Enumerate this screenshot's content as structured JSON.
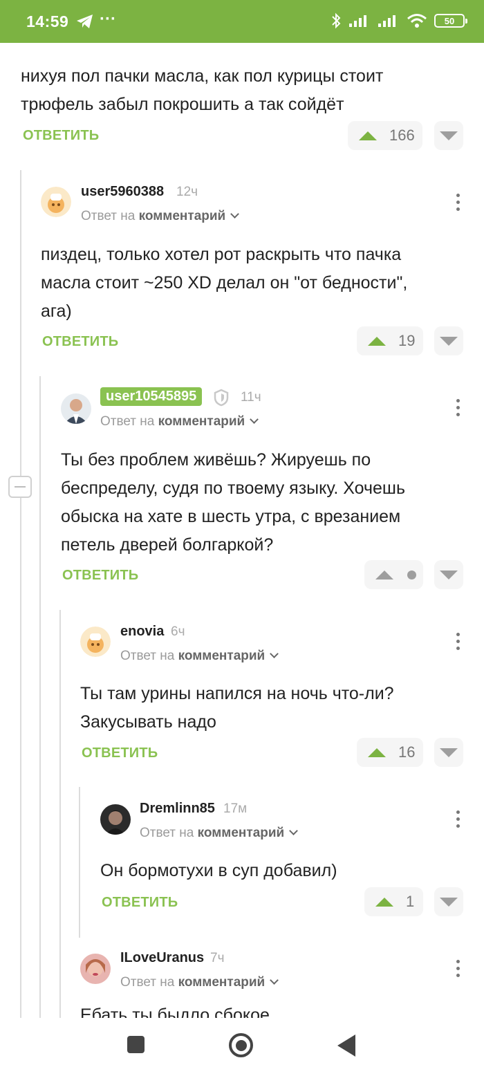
{
  "status_bar": {
    "time": "14:59",
    "battery": "50"
  },
  "top_comment": {
    "text_line1": "нихуя пол пачки масла, как пол курицы стоит",
    "text_line2": "трюфель забыл покрошить а так сойдёт",
    "reply": "ОТВЕТИТЬ",
    "votes": "166"
  },
  "comments": [
    {
      "username": "user5960388",
      "time_ago": "12ч",
      "reply_prefix": "Ответ на",
      "reply_target": "комментарий",
      "lines": [
        "пиздец, только хотел рот раскрыть что пачка",
        "масла стоит ~250 XD делал он \"от бедности\",",
        "ага)"
      ],
      "reply": "ОТВЕТИТЬ",
      "votes": "19"
    },
    {
      "username": "user10545895",
      "time_ago": "11ч",
      "reply_prefix": "Ответ на",
      "reply_target": "комментарий",
      "lines": [
        "Ты без проблем живёшь? Жируешь по",
        "беспределу, судя по твоему языку. Хочешь",
        "обыска на хате в шесть утра, с врезанием",
        "петель дверей болгаркой?"
      ],
      "reply": "ОТВЕТИТЬ",
      "votes": ""
    },
    {
      "username": "enovia",
      "time_ago": "6ч",
      "reply_prefix": "Ответ на",
      "reply_target": "комментарий",
      "lines": [
        "Ты там урины напился на ночь что-ли?",
        "Закусывать надо"
      ],
      "reply": "ОТВЕТИТЬ",
      "votes": "16"
    },
    {
      "username": "Dremlinn85",
      "time_ago": "17м",
      "reply_prefix": "Ответ на",
      "reply_target": "комментарий",
      "lines": [
        "Он бормотухи в суп добавил)"
      ],
      "reply": "ОТВЕТИТЬ",
      "votes": "1"
    },
    {
      "username": "ILoveUranus",
      "time_ago": "7ч",
      "reply_prefix": "Ответ на",
      "reply_target": "комментарий",
      "lines": [
        "Ебать ты быдло сбокое"
      ],
      "reply": "",
      "votes": ""
    }
  ],
  "colors": {
    "accent": "#7cb342",
    "reply": "#8ac251",
    "text": "#222222"
  },
  "icons": [
    "telegram-icon",
    "bluetooth-icon",
    "signal-icon",
    "wifi-icon",
    "battery-icon",
    "kebab-menu-icon",
    "upvote-icon",
    "downvote-icon",
    "collapse-icon",
    "nav-square-icon",
    "nav-home-icon",
    "nav-back-icon"
  ]
}
